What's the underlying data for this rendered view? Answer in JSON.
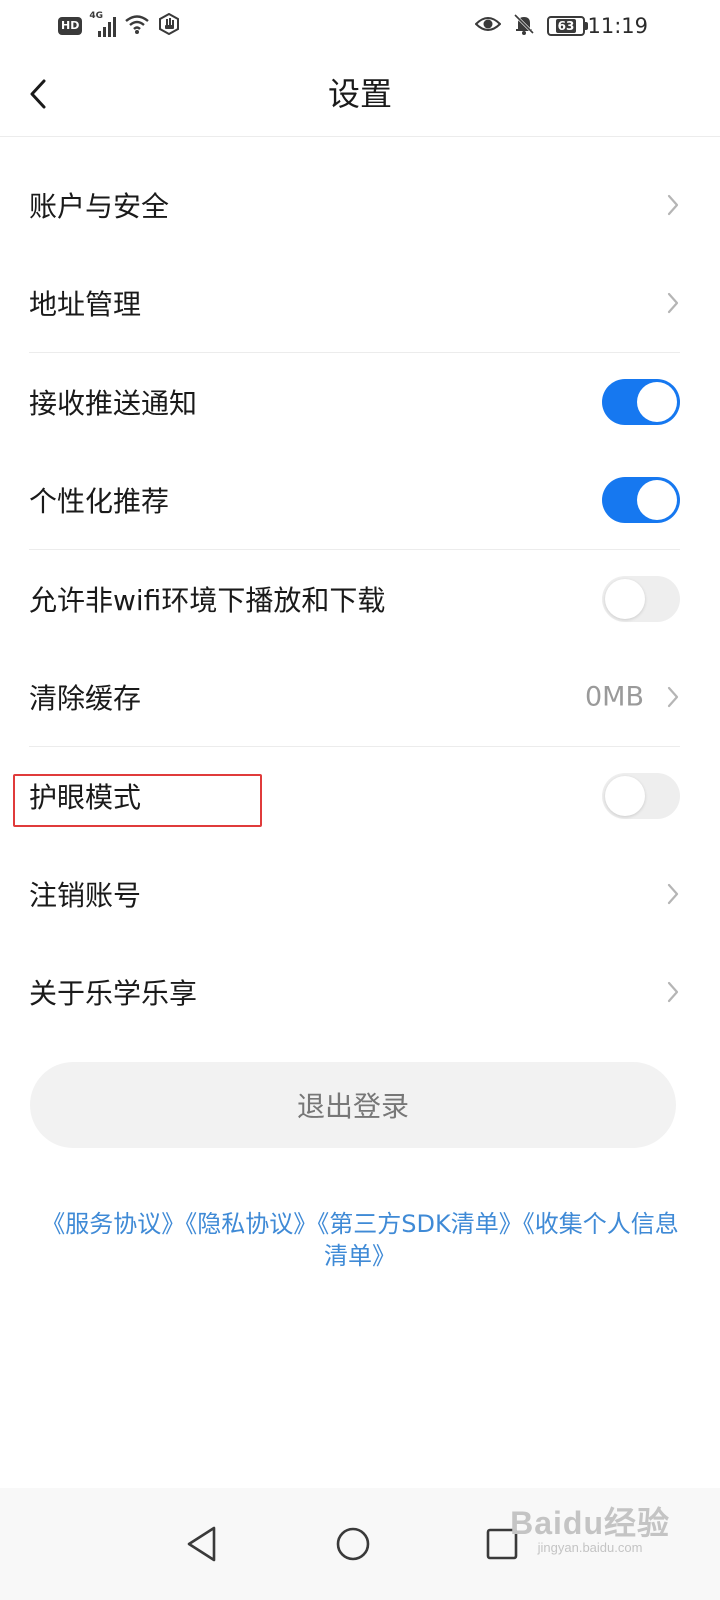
{
  "status_bar": {
    "hd_badge": "HD",
    "network": "4G",
    "battery": "63",
    "time": "11:19",
    "icons": [
      "hd-icon",
      "signal-icon",
      "wifi-icon",
      "hand-icon",
      "eye-icon",
      "bell-off-icon",
      "battery-icon"
    ]
  },
  "header": {
    "title": "设置",
    "back_icon": "chevron-left-icon"
  },
  "settings": {
    "account_security": {
      "label": "账户与安全"
    },
    "address_management": {
      "label": "地址管理"
    },
    "push_notifications": {
      "label": "接收推送通知",
      "enabled": true
    },
    "personalized_recommendation": {
      "label": "个性化推荐",
      "enabled": true
    },
    "non_wifi_download": {
      "label": "允许非wifi环境下播放和下载",
      "enabled": false
    },
    "clear_cache": {
      "label": "清除缓存",
      "value": "0MB"
    },
    "eye_protection": {
      "label": "护眼模式",
      "enabled": false,
      "highlighted": true
    },
    "cancel_account": {
      "label": "注销账号"
    },
    "about": {
      "label": "关于乐学乐享"
    }
  },
  "logout_button": {
    "label": "退出登录"
  },
  "legal_links": {
    "service_agreement": "《服务协议》",
    "privacy_agreement": "《隐私协议》",
    "third_party_sdk": "《第三方SDK清单》",
    "personal_info": "《收集个人信息清单》"
  },
  "nav_bar": {
    "icons": [
      "back-triangle-icon",
      "home-circle-icon",
      "recents-square-icon"
    ]
  },
  "watermark": {
    "main": "Baidu经验",
    "sub": "jingyan.baidu.com"
  },
  "colors": {
    "accent": "#1678f0",
    "link": "#3f8ad6",
    "highlight": "#e03b3b",
    "toggle_off": "#eeeeee",
    "divider": "#ececec"
  }
}
